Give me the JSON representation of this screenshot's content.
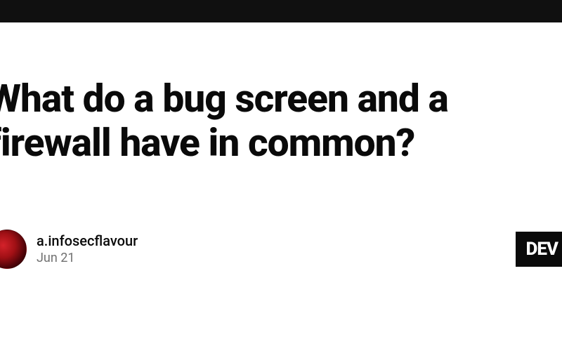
{
  "header": {},
  "article": {
    "title": "What do a bug screen and a firewall have in common?"
  },
  "author": {
    "name": "a.infosecflavour",
    "date": "Jun 21"
  },
  "badge": {
    "label": "DEV"
  }
}
